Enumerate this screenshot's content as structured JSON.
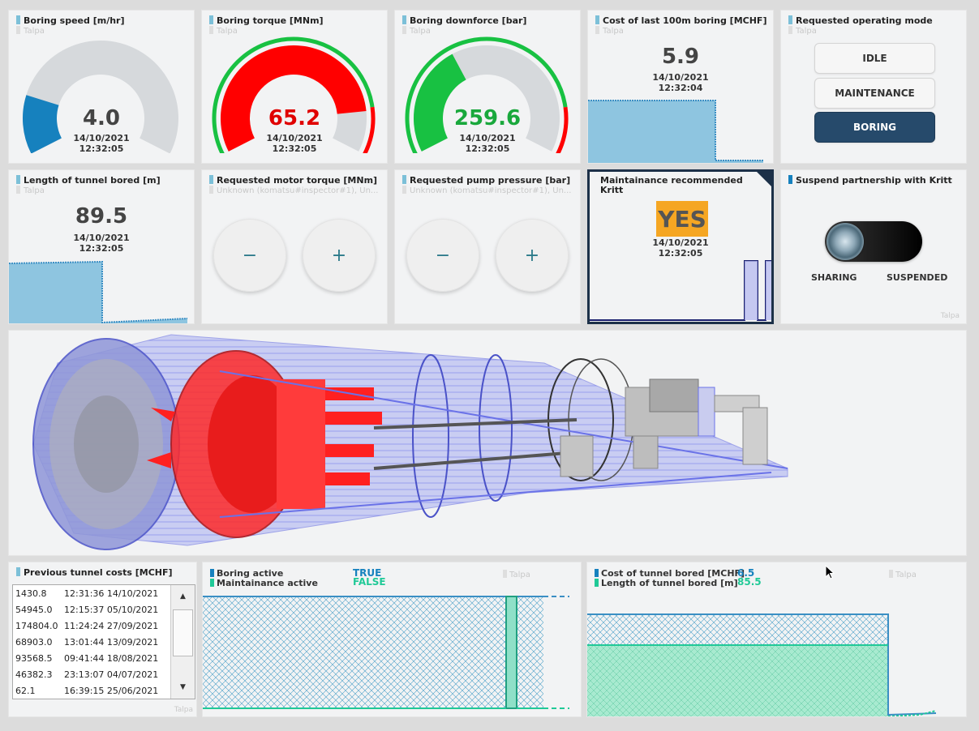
{
  "colors": {
    "accent": "#1681be",
    "red": "#ff0000",
    "green": "#18c142",
    "navy": "#264a6b",
    "teal": "#20c997",
    "orange": "#f5a623"
  },
  "source_label": "Talpa",
  "gauges": [
    {
      "title": "Boring speed [m/hr]",
      "value": "4.0",
      "date": "14/10/2021",
      "time": "12:32:05",
      "fraction": 0.19,
      "fill": "#1681be",
      "value_color": "#444444",
      "ring": false
    },
    {
      "title": "Boring torque [MNm]",
      "value": "65.2",
      "date": "14/10/2021",
      "time": "12:32:05",
      "fraction": 0.86,
      "fill": "#ff0000",
      "value_color": "#e00000",
      "ring": true
    },
    {
      "title": "Boring downforce [bar]",
      "value": "259.6",
      "date": "14/10/2021",
      "time": "12:32:05",
      "fraction": 0.38,
      "fill": "#18c142",
      "value_color": "#19a83c",
      "ring": true
    }
  ],
  "cost_last_100m": {
    "title": "Cost of last 100m boring [MCHF]",
    "value": "5.9",
    "date": "14/10/2021",
    "time": "12:32:04"
  },
  "operating_mode": {
    "title": "Requested operating mode",
    "buttons": [
      "IDLE",
      "MAINTENANCE",
      "BORING"
    ],
    "active": "BORING"
  },
  "tunnel_length": {
    "title": "Length of tunnel bored [m]",
    "value": "89.5",
    "date": "14/10/2021",
    "time": "12:32:05"
  },
  "motor_torque": {
    "title": "Requested motor torque [MNm]",
    "subtitle": "Unknown (komatsu#inspector#1), Un...",
    "minus": "−",
    "plus": "+"
  },
  "pump_pressure": {
    "title": "Requested pump pressure [bar]",
    "subtitle": "Unknown (komatsu#inspector#1), Un...",
    "minus": "−",
    "plus": "+"
  },
  "maintenance": {
    "title": "Maintainance recommended",
    "subtitle": "Kritt",
    "value": "YES",
    "date": "14/10/2021",
    "time": "12:32:05"
  },
  "partnership": {
    "title": "Suspend partnership with Kritt",
    "left_label": "SHARING",
    "right_label": "SUSPENDED"
  },
  "previous_costs": {
    "title": "Previous tunnel costs [MCHF]",
    "rows": [
      {
        "cost": "1430.8",
        "time": "12:31:36 14/10/2021"
      },
      {
        "cost": "54945.0",
        "time": "12:15:37 05/10/2021"
      },
      {
        "cost": "174804.0",
        "time": "11:24:24 27/09/2021"
      },
      {
        "cost": "68903.0",
        "time": "13:01:44 13/09/2021"
      },
      {
        "cost": "93568.5",
        "time": "09:41:44 18/08/2021"
      },
      {
        "cost": "46382.3",
        "time": "23:13:07 04/07/2021"
      },
      {
        "cost": "62.1",
        "time": "16:39:15 25/06/2021"
      }
    ],
    "scroll_up": "▲",
    "scroll_down": "▼"
  },
  "status_chart": {
    "series": [
      {
        "name": "Boring active",
        "value": "TRUE",
        "color": "#1681be"
      },
      {
        "name": "Maintainance active",
        "value": "FALSE",
        "color": "#20c997"
      }
    ]
  },
  "cost_length_chart": {
    "series": [
      {
        "name": "Cost of tunnel bored [MCHF]",
        "value": "6.5",
        "color": "#1681be"
      },
      {
        "name": "Length of tunnel bored [m]",
        "value": "85.5",
        "color": "#20c997"
      }
    ]
  }
}
